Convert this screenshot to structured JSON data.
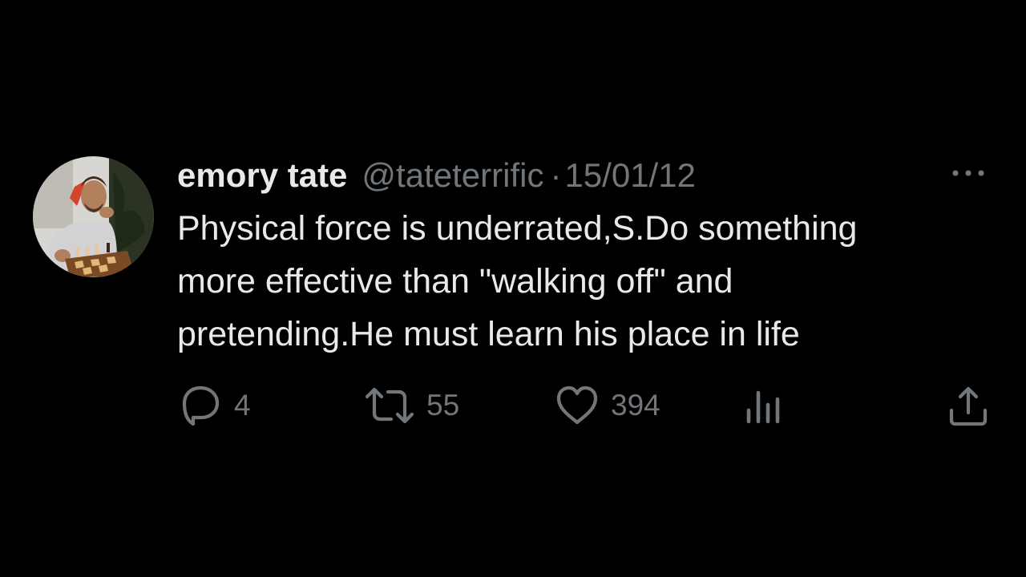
{
  "tweet": {
    "display_name": "emory tate",
    "handle": "@tateterrific",
    "separator": "·",
    "date": "15/01/12",
    "text_lines": [
      "Physical force is underrated,S.Do something",
      "more effective than \"walking off\" and",
      "pretending.He must learn his place in life"
    ],
    "counts": {
      "replies": "4",
      "retweets": "55",
      "likes": "394"
    }
  },
  "icons": {
    "more": "more-horizontal-icon",
    "reply": "reply-icon",
    "retweet": "retweet-icon",
    "like": "heart-icon",
    "views": "views-chart-icon",
    "share": "share-icon"
  },
  "colors": {
    "background": "#000000",
    "primary_text": "#e7e9ea",
    "secondary_text": "#71767b"
  }
}
